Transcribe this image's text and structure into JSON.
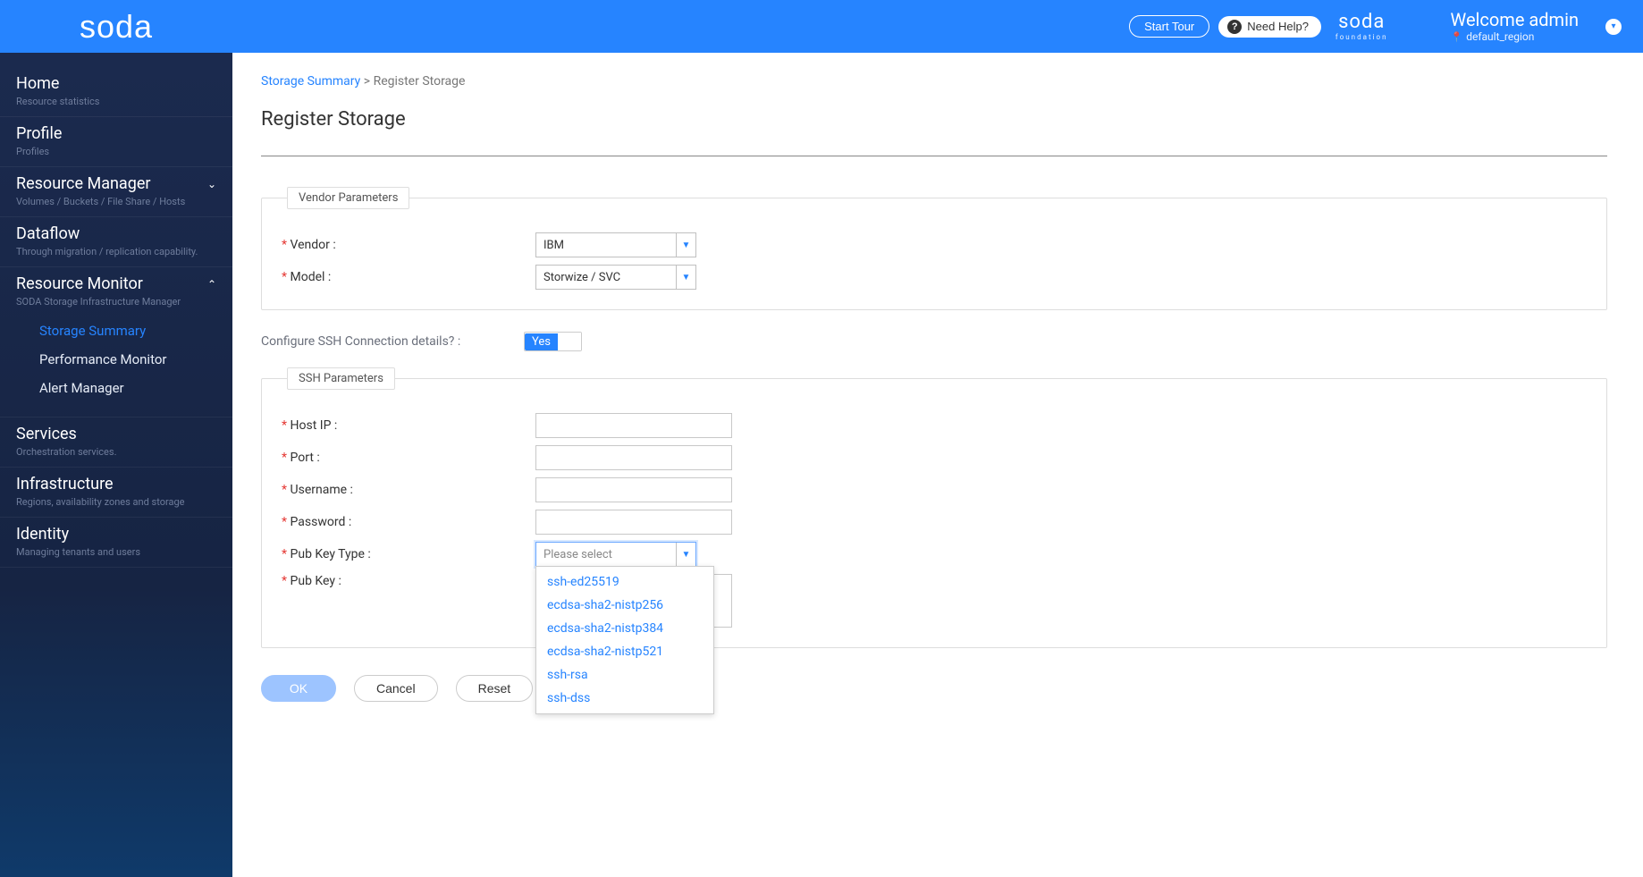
{
  "header": {
    "logo": "soda",
    "start_tour": "Start Tour",
    "need_help": "Need Help?",
    "foundation_top": "soda",
    "foundation_bottom": "foundation",
    "welcome": "Welcome admin",
    "region": "default_region"
  },
  "sidebar": {
    "home": {
      "title": "Home",
      "sub": "Resource statistics"
    },
    "profile": {
      "title": "Profile",
      "sub": "Profiles"
    },
    "resource_manager": {
      "title": "Resource Manager",
      "sub": "Volumes / Buckets / File Share / Hosts"
    },
    "dataflow": {
      "title": "Dataflow",
      "sub": "Through migration / replication capability."
    },
    "resource_monitor": {
      "title": "Resource Monitor",
      "sub": "SODA Storage Infrastructure Manager",
      "items": [
        "Storage Summary",
        "Performance Monitor",
        "Alert Manager"
      ]
    },
    "services": {
      "title": "Services",
      "sub": "Orchestration services."
    },
    "infrastructure": {
      "title": "Infrastructure",
      "sub": "Regions, availability zones and storage"
    },
    "identity": {
      "title": "Identity",
      "sub": "Managing tenants and users"
    }
  },
  "breadcrumb": {
    "root": "Storage Summary",
    "current": "Register Storage"
  },
  "page_title": "Register Storage",
  "vendor_panel": {
    "legend": "Vendor Parameters",
    "vendor_label": "Vendor :",
    "vendor_value": "IBM",
    "model_label": "Model :",
    "model_value": "Storwize / SVC"
  },
  "ssh_toggle": {
    "label": "Configure SSH Connection details? :",
    "value": "Yes"
  },
  "ssh_panel": {
    "legend": "SSH Parameters",
    "host_ip": "Host IP :",
    "port": "Port :",
    "username": "Username :",
    "password": "Password :",
    "pub_key_type": "Pub Key Type :",
    "pub_key_type_placeholder": "Please select",
    "pub_key": "Pub Key :",
    "pub_key_type_options": [
      "ssh-ed25519",
      "ecdsa-sha2-nistp256",
      "ecdsa-sha2-nistp384",
      "ecdsa-sha2-nistp521",
      "ssh-rsa",
      "ssh-dss"
    ]
  },
  "footer": {
    "ok": "OK",
    "cancel": "Cancel",
    "reset": "Reset"
  }
}
